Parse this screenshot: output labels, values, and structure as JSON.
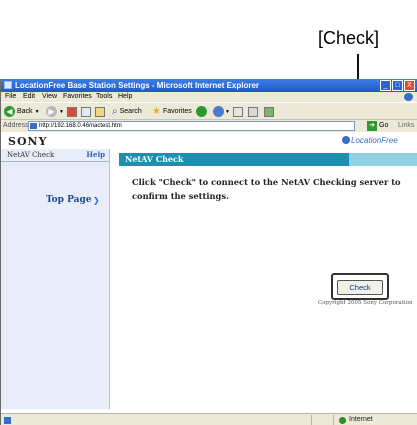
{
  "callout": {
    "label": "[Check]"
  },
  "window": {
    "title": "LocationFree Base Station Settings - Microsoft Internet Explorer",
    "controls": {
      "minimize": "_",
      "maximize": "□",
      "close": "X"
    }
  },
  "menu": [
    "File",
    "Edit",
    "View",
    "Favorites",
    "Tools",
    "Help"
  ],
  "toolbar": {
    "back": "Back",
    "search": "Search",
    "favorites": "Favorites"
  },
  "address": {
    "label": "Address",
    "url": "http://192.168.0.46/nactest.htm",
    "go": "Go",
    "links": "Links"
  },
  "header": {
    "logo": "SONY",
    "brand": "LocationFree"
  },
  "sidebar": {
    "title": "NetAV Check",
    "help": "Help",
    "top_page": "Top Page"
  },
  "main": {
    "heading": "NetAV Check",
    "instruction": "Click \"Check\" to connect to the NetAV Checking server to confirm the settings.",
    "check_label": "Check",
    "copyright": "Copyright 2005 Sony Corporation"
  },
  "status": {
    "zone": "Internet"
  },
  "colors": {
    "header_bar": "#1e8fb0",
    "sidebar_bg": "#e8edf9",
    "title_bar": "#2f6ee0"
  }
}
